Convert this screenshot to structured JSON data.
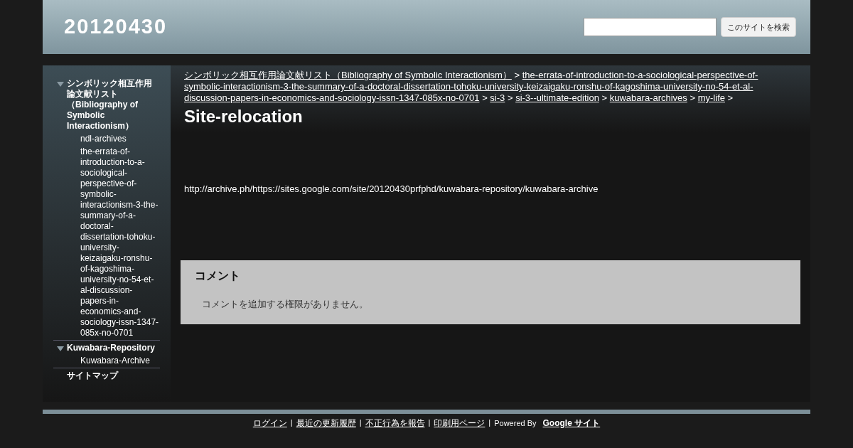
{
  "header": {
    "site_title": "20120430",
    "search": {
      "button": "このサイトを検索"
    }
  },
  "sidebar": {
    "items": [
      {
        "label": "シンボリック相互作用論文献リスト（Bibliography of Symbolic Interactionism）",
        "expanded": true,
        "children": [
          {
            "label": "ndl-archives"
          },
          {
            "label": "the-errata-of-introduction-to-a-sociological-perspective-of-symbolic-interactionism-3-the-summary-of-a-doctoral-dissertation-tohoku-university-keizaigaku-ronshu-of-kagoshima-university-no-54-et-al-discussion-papers-in-economics-and-sociology-issn-1347-085x-no-0701"
          }
        ]
      },
      {
        "label": "Kuwabara-Repository",
        "expanded": true,
        "children": [
          {
            "label": "Kuwabara-Archive"
          }
        ]
      },
      {
        "label": "サイトマップ",
        "expanded": false
      }
    ]
  },
  "breadcrumb": {
    "separator": ">",
    "links": [
      "シンボリック相互作用論文献リスト（Bibliography of Symbolic Interactionism）",
      "the-errata-of-introduction-to-a-sociological-perspective-of-symbolic-interactionism-3-the-summary-of-a-doctoral-dissertation-tohoku-university-keizaigaku-ronshu-of-kagoshima-university-no-54-et-al-discussion-papers-in-economics-and-sociology-issn-1347-085x-no-0701",
      "si-3",
      "si-3--ultimate-edition",
      "kuwabara-archives",
      "my-life"
    ]
  },
  "page_title": "Site-relocation",
  "body_text": "http://archive.ph/https://sites.google.com/site/20120430prfphd/kuwabara-repository/kuwabara-archive",
  "comments": {
    "heading": "コメント",
    "message": "コメントを追加する権限がありません。"
  },
  "footer": {
    "separator": "|",
    "links": [
      "ログイン",
      "最近の更新履歴",
      "不正行為を報告",
      "印刷用ページ"
    ],
    "powered_by": "Powered By",
    "brand_link": "Google サイト"
  }
}
